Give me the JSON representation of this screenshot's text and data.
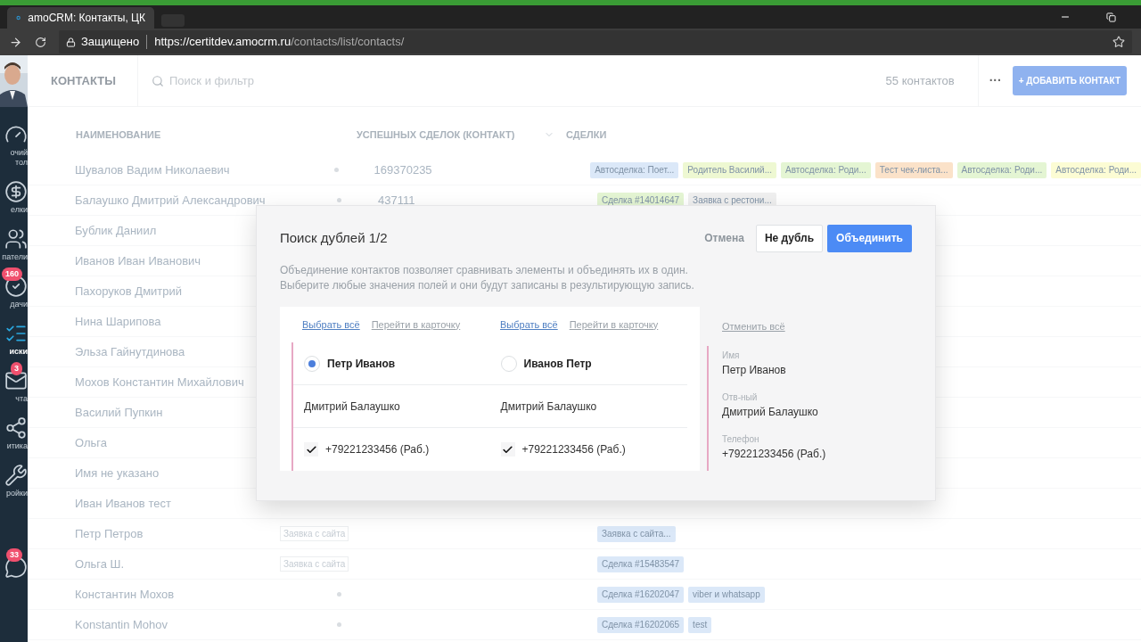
{
  "browser": {
    "tab_title": "amoCRM: Контакты, ЦК",
    "secure_label": "Защищено",
    "url_host": "https://certitdev.amocrm.ru",
    "url_path": "/contacts/list/contacts/"
  },
  "sidebar": {
    "items": [
      {
        "label": "очий тол",
        "selected": false
      },
      {
        "label": "елки",
        "selected": false
      },
      {
        "label": "патели",
        "selected": false
      },
      {
        "label": "дачи",
        "selected": false,
        "badge": "160"
      },
      {
        "label": "иски",
        "selected": true
      },
      {
        "label": "чта",
        "selected": false,
        "badge": "3"
      },
      {
        "label": "итика",
        "selected": false
      },
      {
        "label": "ройки",
        "selected": false
      },
      {
        "selected": false,
        "badge": "33"
      }
    ]
  },
  "header": {
    "title": "КОНТАКТЫ",
    "search_placeholder": "Поиск и фильтр",
    "count": "55 контактов",
    "more": "···",
    "add_button": "+ ДОБАВИТЬ КОНТАКТ"
  },
  "table": {
    "columns": [
      "НАИМЕНОВАНИЕ",
      "УСПЕШНЫХ СДЕЛОК (КОНТАКТ)",
      "СДЕЛКИ"
    ],
    "rows": [
      {
        "name": "Шувалов Вадим Николаевич",
        "column_2": {
          "kind": "dot"
        },
        "successful": "169370235",
        "deals": [
          {
            "text": "Автосделка: Поет...",
            "color": "#dbe8f8"
          },
          {
            "text": "Родитель Василий...",
            "color": "#eef8d2"
          },
          {
            "text": "Автосделка: Роди...",
            "color": "#e4f5d3"
          },
          {
            "text": "Тест чек-листа...",
            "color": "#fbe2c9"
          },
          {
            "text": "Автосделка: Роди...",
            "color": "#e4f5d3"
          },
          {
            "text": "Автосделка: Роди...",
            "color": "#fcfcd4"
          }
        ]
      },
      {
        "name": "Балаушко Дмитрий Александрович",
        "column_2": {
          "kind": "dot"
        },
        "successful": "437111",
        "deals": [
          {
            "text": "Сделка #14014647",
            "color": "#e4f5d3"
          },
          {
            "text": "Заявка с рестони...",
            "color": "#efefef"
          }
        ]
      },
      {
        "name": "Бублик Даниил"
      },
      {
        "name": "Иванов Иван Иванович"
      },
      {
        "name": "Пахоруков Дмитрий"
      },
      {
        "name": "Нина Шарипова"
      },
      {
        "name": "Эльза Гайнутдинова"
      },
      {
        "name": "Мохов Константин Михайлович"
      },
      {
        "name": "Василий Пупкин"
      },
      {
        "name": "Ольга"
      },
      {
        "name": "Имя не указано"
      },
      {
        "name": "Иван Иванов тест"
      },
      {
        "name": "Петр Петров",
        "column_2": {
          "kind": "tag",
          "text": "Заявка с сайта"
        },
        "deals": [
          {
            "text": "Заявка с сайта...",
            "color": "#dbe8f8"
          }
        ]
      },
      {
        "name": "Ольга Ш.",
        "column_2": {
          "kind": "tag",
          "text": "Заявка с сайта"
        },
        "deals": [
          {
            "text": "Сделка #15483547",
            "color": "#dbe8f8"
          }
        ]
      },
      {
        "name": "Константин Мохов",
        "column_2": {
          "kind": "dot"
        },
        "deals": [
          {
            "text": "Сделка #16202047",
            "color": "#dbe8f8"
          },
          {
            "text": "viber и whatsapp",
            "color": "#dbe8f8"
          }
        ]
      },
      {
        "name": "Konstantin Mohov",
        "column_2": {
          "kind": "dot"
        },
        "deals": [
          {
            "text": "Сделка #16202065",
            "color": "#dbe8f8"
          },
          {
            "text": "test",
            "color": "#dbe8f8"
          }
        ]
      }
    ]
  },
  "modal": {
    "title": "Поиск дублей 1/2",
    "cancel": "Отмена",
    "not_duplicate": "Не дубль",
    "merge": "Объединить",
    "description": [
      "Объединение контактов позволяет сравнивать элементы и объединять их в один.",
      "Выберите любые значения полей и они будут записаны в результирующую запись."
    ],
    "candidates": [
      {
        "select_all": "Выбрать всё",
        "open_card": "Перейти в карточку",
        "name": "Петр Иванов",
        "selected": true,
        "responsible": "Дмитрий Балаушко",
        "phone": "+79221233456 (Раб.)",
        "phone_checked": true
      },
      {
        "select_all": "Выбрать всё",
        "open_card": "Перейти в карточку",
        "name": "Иванов Петр",
        "selected": false,
        "responsible": "Дмитрий Балаушко",
        "phone": "+79221233456 (Раб.)",
        "phone_checked": true
      }
    ],
    "result": {
      "cancel_all": "Отменить всё",
      "fields": [
        {
          "label": "Имя",
          "value": "Петр Иванов"
        },
        {
          "label": "Отв-ный",
          "value": "Дмитрий Балаушко"
        },
        {
          "label": "Телефон",
          "value": "+79221233456 (Раб.)"
        }
      ]
    }
  }
}
